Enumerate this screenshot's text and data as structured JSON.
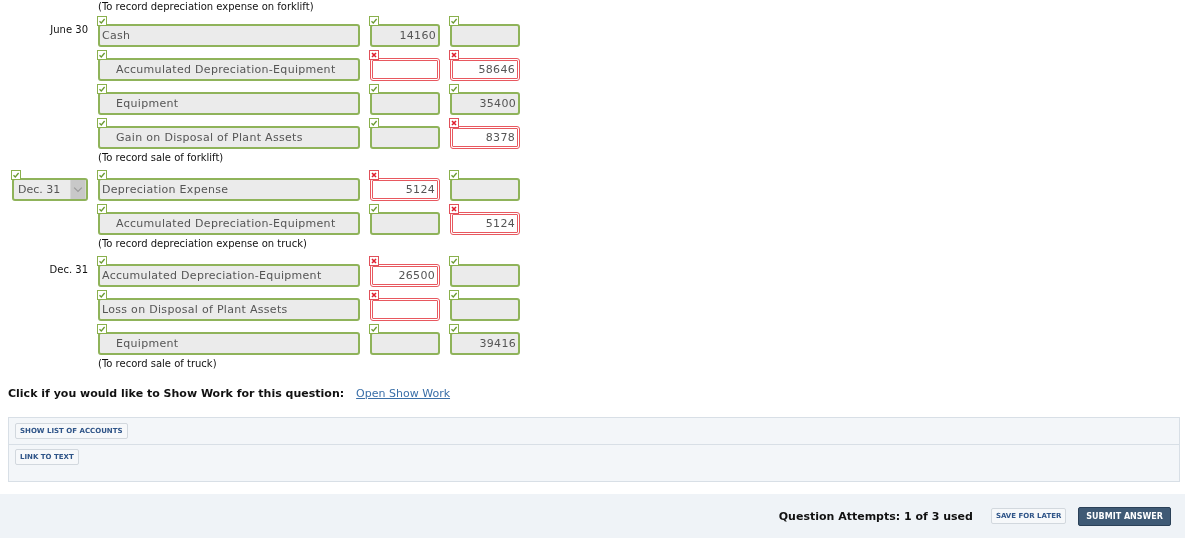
{
  "top_note": "(To record depreciation expense on forklift)",
  "entries": [
    {
      "date": {
        "kind": "text",
        "value": "June 30"
      },
      "lines": [
        {
          "account": {
            "value": "Cash",
            "indent": false,
            "correct": true
          },
          "debit": {
            "value": "14160",
            "correct": true
          },
          "credit": {
            "correct": true
          }
        },
        {
          "account": {
            "value": "Accumulated Depreciation-Equipment",
            "indent": true,
            "correct": true
          },
          "debit": {
            "correct": false
          },
          "credit": {
            "value": "58646",
            "correct": false
          }
        },
        {
          "account": {
            "value": "Equipment",
            "indent": true,
            "correct": true
          },
          "debit": {
            "correct": true
          },
          "credit": {
            "value": "35400",
            "correct": true
          }
        },
        {
          "account": {
            "value": "Gain on Disposal of Plant Assets",
            "indent": true,
            "correct": true
          },
          "debit": {
            "correct": true
          },
          "credit": {
            "value": "8378",
            "correct": false
          }
        }
      ],
      "note": "(To record sale of forklift)"
    },
    {
      "date": {
        "kind": "select",
        "value": "Dec. 31",
        "correct": true
      },
      "lines": [
        {
          "account": {
            "value": "Depreciation Expense",
            "indent": false,
            "correct": true
          },
          "debit": {
            "value": "5124",
            "correct": false
          },
          "credit": {
            "correct": true
          }
        },
        {
          "account": {
            "value": "Accumulated Depreciation-Equipment",
            "indent": true,
            "correct": true
          },
          "debit": {
            "correct": true
          },
          "credit": {
            "value": "5124",
            "correct": false
          }
        }
      ],
      "note": "(To record depreciation expense on truck)"
    },
    {
      "date": {
        "kind": "text",
        "value": "Dec. 31"
      },
      "lines": [
        {
          "account": {
            "value": "Accumulated Depreciation-Equipment",
            "indent": false,
            "correct": true
          },
          "debit": {
            "value": "26500",
            "correct": false
          },
          "credit": {
            "correct": true
          }
        },
        {
          "account": {
            "value": "Loss on Disposal of Plant Assets",
            "indent": false,
            "correct": true
          },
          "debit": {
            "correct": false
          },
          "credit": {
            "correct": true
          }
        },
        {
          "account": {
            "value": "Equipment",
            "indent": true,
            "correct": true
          },
          "debit": {
            "correct": true
          },
          "credit": {
            "value": "39416",
            "correct": true
          }
        }
      ],
      "note": "(To record sale of truck)"
    }
  ],
  "show_work": {
    "prompt": "Click if you would like to Show Work for this question:",
    "link": "Open Show Work"
  },
  "tools": [
    "SHOW LIST OF ACCOUNTS",
    "LINK TO TEXT"
  ],
  "footer": {
    "attempts": "Question Attempts: 1 of 3 used",
    "save": "SAVE FOR LATER",
    "submit": "SUBMIT ANSWER"
  }
}
